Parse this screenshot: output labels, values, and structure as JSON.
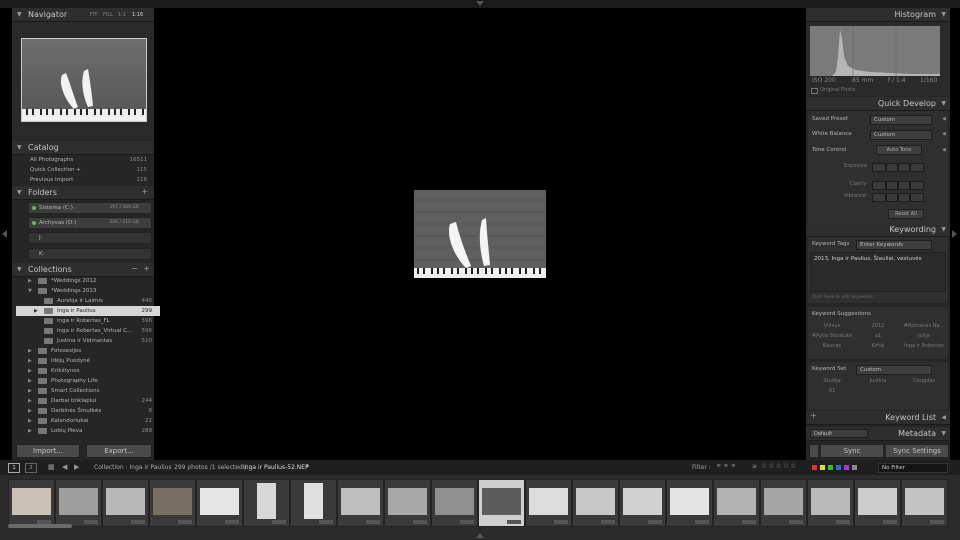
{
  "left": {
    "navigator": {
      "title": "Navigator",
      "zoom": [
        "FIT",
        "FILL",
        "1:1",
        "1:16"
      ]
    },
    "catalog": {
      "title": "Catalog",
      "items": [
        {
          "label": "All Photographs",
          "count": "16511"
        },
        {
          "label": "Quick Collection +",
          "count": "115"
        },
        {
          "label": "Previous Import",
          "count": "118"
        }
      ]
    },
    "folders": {
      "title": "Folders",
      "plus": "+",
      "drives": [
        {
          "label": "Sistema (C:)",
          "info": "197 / 300 GB"
        },
        {
          "label": "Archyvas (D:)",
          "info": "206 / 410 GB"
        },
        {
          "label": "J:",
          "info": ""
        },
        {
          "label": "K:",
          "info": ""
        }
      ]
    },
    "collections": {
      "title": "Collections",
      "minus": "−",
      "plus": "+",
      "items": [
        {
          "label": "*Weddings 2012",
          "count": "",
          "indent": 0
        },
        {
          "label": "*Weddings 2013",
          "count": "",
          "indent": 0
        },
        {
          "label": "Aurelija ir Laimis",
          "count": "440",
          "indent": 1
        },
        {
          "label": "Inga ir Paulius",
          "count": "299",
          "indent": 1,
          "selected": true
        },
        {
          "label": "Inga ir Robertas_FL",
          "count": "596",
          "indent": 1
        },
        {
          "label": "Inga ir Robertas_Virtual C...",
          "count": "596",
          "indent": 1
        },
        {
          "label": "Justina ir Vidmantas",
          "count": "510",
          "indent": 1
        },
        {
          "label": "Fotosesijos",
          "count": "",
          "indent": 0
        },
        {
          "label": "Idėjų Puodynė",
          "count": "",
          "indent": 0
        },
        {
          "label": "Krikštynos",
          "count": "",
          "indent": 0
        },
        {
          "label": "Photography Life",
          "count": "",
          "indent": 0
        },
        {
          "label": "Smart Collections",
          "count": "",
          "indent": 0
        },
        {
          "label": "Darbai tinklapiui",
          "count": "244",
          "indent": 0
        },
        {
          "label": "Darbinės Šmutkės",
          "count": "8",
          "indent": 0
        },
        {
          "label": "Kalendoriukai",
          "count": "22",
          "indent": 0
        },
        {
          "label": "Lobių Pieva",
          "count": "289",
          "indent": 0
        }
      ]
    },
    "buttons": {
      "import": "Import...",
      "export": "Export..."
    }
  },
  "right": {
    "histogram": {
      "title": "Histogram",
      "info": [
        "ISO 200",
        "85 mm",
        "f / 1.4",
        "1/160"
      ],
      "original": "Original Photo"
    },
    "quick_develop": {
      "title": "Quick Develop",
      "saved_preset_label": "Saved Preset",
      "saved_preset_value": "Custom",
      "white_balance_label": "White Balance",
      "white_balance_value": "Custom",
      "tone_control_label": "Tone Control",
      "auto_tone": "Auto Tone",
      "exposure": "Exposure",
      "clarity": "Clarity",
      "vibrance": "Vibrance",
      "reset_all": "Reset All"
    },
    "keywording": {
      "title": "Keywording",
      "keyword_tags_label": "Keyword Tags",
      "keyword_tags_value": "Enter Keywords",
      "keywords_text": "2013, Inga ir Paulius, Šiauliai, vestuvės",
      "add_hint": "Click here to add keywords",
      "suggestions_title": "Keyword Suggestions",
      "suggestions": [
        "Vilnius",
        "2012",
        "#Romanas Na...",
        "#Rytis Stonkutė",
        "a1",
        "Julija",
        "Kaunas",
        "Kirtai",
        "Inga ir Robertas"
      ],
      "keyword_set_label": "Keyword Set",
      "keyword_set_value": "Custom",
      "set_items": [
        "Studija",
        "Justina",
        "Daugdas",
        "A1",
        "",
        ""
      ]
    },
    "keyword_list": {
      "title": "Keyword List",
      "plus": "+"
    },
    "metadata": {
      "title": "Metadata",
      "preset": "Default"
    },
    "buttons": {
      "sync": "Sync",
      "sync_settings": "Sync Settings"
    }
  },
  "filmbar": {
    "pages": [
      "1",
      "2"
    ],
    "collection_label": "Collection : Inga ir Paulius",
    "count_text": "299 photos /1 selected /",
    "filename": "Inga ir Paulius-52.NEF",
    "filter_label": "Filter :",
    "filter_value": "No Filter"
  },
  "colors": {
    "bg": "#000000",
    "panel": "#262626",
    "header": "#2e2e2e",
    "selected": "#d6d6d6"
  }
}
